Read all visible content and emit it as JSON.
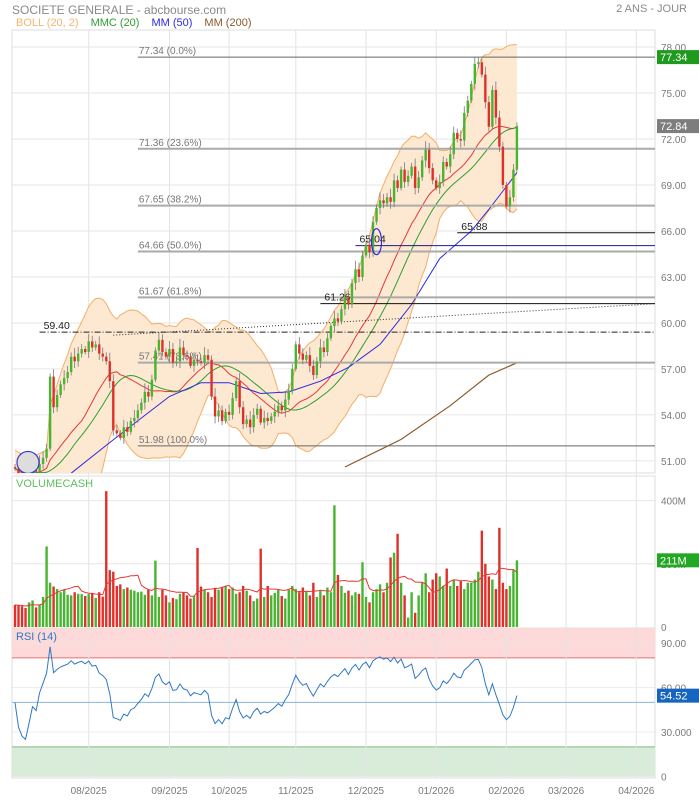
{
  "header": {
    "title": "SOCIETE GENERALE - abcbourse.com",
    "period": "2 ANS - JOUR"
  },
  "legend": [
    {
      "label": "BOLL (20, 2)",
      "color": "#f5b56e"
    },
    {
      "label": "MMC (20)",
      "color": "#2e9e2e"
    },
    {
      "label": "MM (50)",
      "color": "#2a2ae0"
    },
    {
      "label": "MM (200)",
      "color": "#8b5a2b"
    }
  ],
  "colors": {
    "up": "#47b52f",
    "down": "#e0302a",
    "boll_fill": "#fde8d2",
    "boll_line": "#f3ae66",
    "mid": "#e53935",
    "mmc": "#2e9e2e",
    "mm50": "#2a2ae0",
    "mm200": "#8b5a2b",
    "vol_ma": "#e53935",
    "rsi": "#2f78c4"
  },
  "chart_data": {
    "type": "candlestick",
    "x_ticks": [
      {
        "label": "08/2025",
        "index": 21
      },
      {
        "label": "09/2025",
        "index": 44
      },
      {
        "label": "10/2025",
        "index": 61
      },
      {
        "label": "11/2025",
        "index": 80
      },
      {
        "label": "12/2025",
        "index": 100
      },
      {
        "label": "01/2026",
        "index": 120
      },
      {
        "label": "02/2026",
        "index": 140
      },
      {
        "label": "03/2026",
        "index": 157
      },
      {
        "label": "04/2026",
        "index": 177
      }
    ],
    "price": {
      "y_ticks": [
        "78.00",
        "75.00",
        "72.00",
        "69.00",
        "66.00",
        "63.00",
        "60.00",
        "57.00",
        "54.00",
        "51.00"
      ],
      "ylim": [
        50.2,
        79.0
      ],
      "first_open": 50.6,
      "closes": [
        50.5,
        50.2,
        50.0,
        49.9,
        50.1,
        50.4,
        50.3,
        50.8,
        51.2,
        51.8,
        56.5,
        54.5,
        55.3,
        56.0,
        56.4,
        56.8,
        57.8,
        57.5,
        58.0,
        58.3,
        58.1,
        58.8,
        58.4,
        58.6,
        58.0,
        57.8,
        57.5,
        56.2,
        53.0,
        52.8,
        52.5,
        53.2,
        52.9,
        53.6,
        53.8,
        54.3,
        54.8,
        55.5,
        55.2,
        56.3,
        58.2,
        58.9,
        58.1,
        57.8,
        58.3,
        57.4,
        57.5,
        58.4,
        57.9,
        57.8,
        57.2,
        57.6,
        57.5,
        57.4,
        57.9,
        57.6,
        55.2,
        53.9,
        54.3,
        53.6,
        54.2,
        54.0,
        55.1,
        56.2,
        54.5,
        53.4,
        53.7,
        53.2,
        54.0,
        54.4,
        53.5,
        53.8,
        53.6,
        53.9,
        54.2,
        54.6,
        54.3,
        55.0,
        55.6,
        57.0,
        58.6,
        58.0,
        57.6,
        57.9,
        57.2,
        56.6,
        57.5,
        58.4,
        58.1,
        59.0,
        59.8,
        60.3,
        60.1,
        60.9,
        61.7,
        61.2,
        62.6,
        63.5,
        63.0,
        64.4,
        65.1,
        64.6,
        66.6,
        67.5,
        68.0,
        67.8,
        68.2,
        67.9,
        69.3,
        68.8,
        70.0,
        69.2,
        69.6,
        70.2,
        68.8,
        69.5,
        70.6,
        71.3,
        70.1,
        69.3,
        68.8,
        69.2,
        70.5,
        70.2,
        71.0,
        72.4,
        72.0,
        71.9,
        73.7,
        74.5,
        75.6,
        76.9,
        77.0,
        76.2,
        74.4,
        72.8,
        75.2,
        73.4,
        71.5,
        69.0,
        67.6,
        68.2,
        70.0,
        72.84
      ],
      "mm50": [
        [
          0,
          47.5
        ],
        [
          7,
          48.6
        ],
        [
          16,
          50.2
        ],
        [
          27,
          52.2
        ],
        [
          36,
          53.8
        ],
        [
          44,
          55.2
        ],
        [
          53,
          56.1
        ],
        [
          61,
          56.1
        ],
        [
          70,
          55.4
        ],
        [
          78,
          55.5
        ],
        [
          87,
          56.2
        ],
        [
          95,
          57.1
        ],
        [
          104,
          58.6
        ],
        [
          113,
          61.2
        ],
        [
          121,
          64.2
        ],
        [
          130,
          66.0
        ],
        [
          135,
          67.4
        ],
        [
          140,
          68.9
        ],
        [
          143,
          69.8
        ]
      ],
      "mm200": [
        [
          94,
          50.6
        ],
        [
          110,
          52.4
        ],
        [
          124,
          54.6
        ],
        [
          135,
          56.6
        ],
        [
          143,
          57.4
        ]
      ],
      "fibonacci": [
        {
          "price": 77.34,
          "label": "77.34  (0.0%)"
        },
        {
          "price": 71.36,
          "label": "71.36  (23.6%)"
        },
        {
          "price": 67.65,
          "label": "67.65  (38.2%)"
        },
        {
          "price": 64.66,
          "label": "64.66  (50.0%)"
        },
        {
          "price": 61.67,
          "label": "61.67  (61.8%)"
        },
        {
          "price": 57.41,
          "label": "57.41  (78.6%)"
        },
        {
          "price": 51.98,
          "label": "51.98  (100.0%)"
        }
      ],
      "fib_start_index": 35,
      "levels": [
        {
          "price": 65.88,
          "label": "65.88",
          "start_index": 126,
          "style": "solid",
          "color": "#111"
        },
        {
          "price": 65.04,
          "label": "65.04",
          "start_index": 97,
          "style": "solid",
          "color": "#1a1a8c"
        },
        {
          "price": 61.26,
          "label": "61.26",
          "start_index": 87,
          "style": "solid",
          "color": "#111"
        },
        {
          "price": 59.4,
          "label": "59.40",
          "start_index": 7,
          "style": "dashdot",
          "color": "#222"
        }
      ],
      "trendline": {
        "start": [
          28,
          59.2
        ],
        "end": [
          182,
          61.25
        ]
      },
      "last_badge": "72.84",
      "high_badge": "77.34"
    },
    "volume": {
      "title": "VOLUMECASH",
      "unit": "M",
      "y_ticks": [
        {
          "label": "400M",
          "value": 400
        },
        {
          "label": "200M",
          "value": 200
        },
        {
          "label": "0",
          "value": 0
        }
      ],
      "values": [
        70,
        68,
        66,
        60,
        78,
        84,
        62,
        72,
        95,
        255,
        140,
        128,
        120,
        110,
        118,
        102,
        100,
        110,
        105,
        104,
        98,
        104,
        108,
        92,
        110,
        96,
        430,
        180,
        175,
        130,
        135,
        120,
        125,
        118,
        115,
        110,
        112,
        102,
        118,
        100,
        210,
        95,
        118,
        100,
        78,
        92,
        88,
        105,
        110,
        100,
        90,
        98,
        250,
        128,
        118,
        110,
        95,
        122,
        118,
        125,
        130,
        120,
        125,
        105,
        110,
        130,
        115,
        100,
        82,
        90,
        248,
        95,
        130,
        100,
        108,
        118,
        98,
        90,
        118,
        130,
        120,
        110,
        125,
        112,
        100,
        140,
        95,
        115,
        100,
        125,
        110,
        385,
        165,
        130,
        108,
        115,
        100,
        110,
        105,
        205,
        95,
        78,
        110,
        120,
        135,
        110,
        140,
        220,
        235,
        295,
        140,
        100,
        30,
        110,
        45,
        100,
        140,
        170,
        110,
        150,
        170,
        160,
        130,
        185,
        130,
        150,
        130,
        145,
        120,
        140,
        140,
        150,
        175,
        305,
        200,
        160,
        150,
        120,
        314,
        140,
        120,
        130,
        180,
        211
      ],
      "ma_period": 10,
      "last_badge": "211M"
    },
    "rsi": {
      "title": "RSI (14)",
      "period": 14,
      "y_ticks": [
        {
          "label": "90.00",
          "value": 90
        },
        {
          "label": "60.00",
          "value": 60
        },
        {
          "label": "30.000",
          "value": 30
        },
        {
          "label": "0",
          "value": 0
        }
      ],
      "overbought": 80,
      "oversold": 20,
      "midline": 50,
      "last_badge": "54.52"
    }
  }
}
